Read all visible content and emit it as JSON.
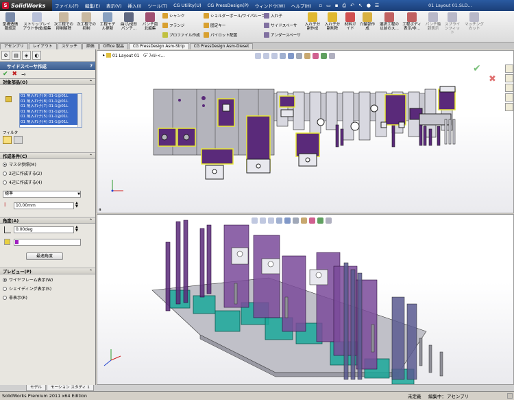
{
  "app": {
    "logo_text": "SolidWorks",
    "doc_title": "01 Layout 01.SLD..."
  },
  "menu": [
    "ファイル(F)",
    "編集(E)",
    "表示(V)",
    "挿入(I)",
    "ツール(T)",
    "CG Utility(U)",
    "CG PressDesign(P)",
    "ウィンドウ(W)",
    "ヘルプ(H)"
  ],
  "ribbon": {
    "big": [
      {
        "label": "型構造情報設定"
      },
      {
        "label": "ストリップレイアウト作成/編集"
      },
      {
        "label": "次工程での抑制解除"
      },
      {
        "label": "次工程での抑制"
      },
      {
        "label": "工程モデル更新"
      },
      {
        "label": "曲げ/成形パンチ..."
      },
      {
        "label": "パンチ南北編集"
      },
      {
        "label": "入れ子分割作成"
      },
      {
        "label": "入れ子分割削除"
      },
      {
        "label": "材料ガイド"
      },
      {
        "label": "穴輪郭作成"
      },
      {
        "label": "選択工程の以前のス..."
      },
      {
        "label": "工程ボディ表示/非..."
      },
      {
        "label": "パンチ輪郭表示"
      },
      {
        "label": "スプラインフィット"
      },
      {
        "label": "マッチングカット"
      }
    ],
    "small": [
      "シャンク",
      "フランジ",
      "プロファイル作成",
      "ショルダーボール/ワイパルーフ",
      "固定キー",
      "パイロット配置",
      "入れ子",
      "サイドスペーサ",
      "アンダースペーサ"
    ]
  },
  "tabs": [
    "アセンブリ",
    "レイアウト",
    "スケッチ",
    "評価",
    "Office 製品",
    "CG PressDesign Asm-Strip",
    "CG PressDesign Asm-Dieset"
  ],
  "active_tab": "CG PressDesign Asm-Strip",
  "panel": {
    "title": "サイドスペーサ作成",
    "help": "?",
    "ok": "✔",
    "cancel": "✖",
    "pin": "⊸",
    "sec_parts": "対象部品(O)",
    "parts": [
      "01 角入れ子(9) 01-1@01L",
      "01 角入れ子(8) 01-1@01L",
      "01 角入れ子(7) 01-1@01L",
      "01 角入れ子(6) 01-1@01L",
      "01 角入れ子(5) 01-1@01L",
      "01 角入れ子(4) 01-1@01L"
    ],
    "filter_label": "フィルタ",
    "sec_cond": "作成条件(C)",
    "cond_options": [
      "マスタ参照(M)",
      "2辺に作成する(2)",
      "4辺に作成する(4)"
    ],
    "cond_selected": 0,
    "select_value": "標準",
    "thickness": "10.00mm",
    "sec_angle": "角度(A)",
    "angle_value": "0.00deg",
    "angle_button": "最適角度",
    "sec_preview": "プレビュー(P)",
    "preview_options": [
      "ワイヤフレーム表示(W)",
      "シェイディング表示(S)",
      "非表示(R)"
    ],
    "preview_selected": 0
  },
  "viewport": {
    "tree_label": "01 Layout 01 （ﾃﾞﾌｫﾙﾄ<...",
    "view_label_a": "a"
  },
  "bottom_tabs": [
    "モデル",
    "モーション スタディ 1"
  ],
  "status": {
    "left": "SolidWorks Premium 2011 x64 Edition",
    "mid1": "未定義",
    "mid2": "編集中：",
    "mid3": "アセンブリ"
  },
  "colors": {
    "accent": "#3d5e90",
    "selection": "#3a6ac8",
    "part_purple": "#5a2a7a",
    "highlight_yellow": "#e8e832",
    "teal": "#1aa89a"
  }
}
